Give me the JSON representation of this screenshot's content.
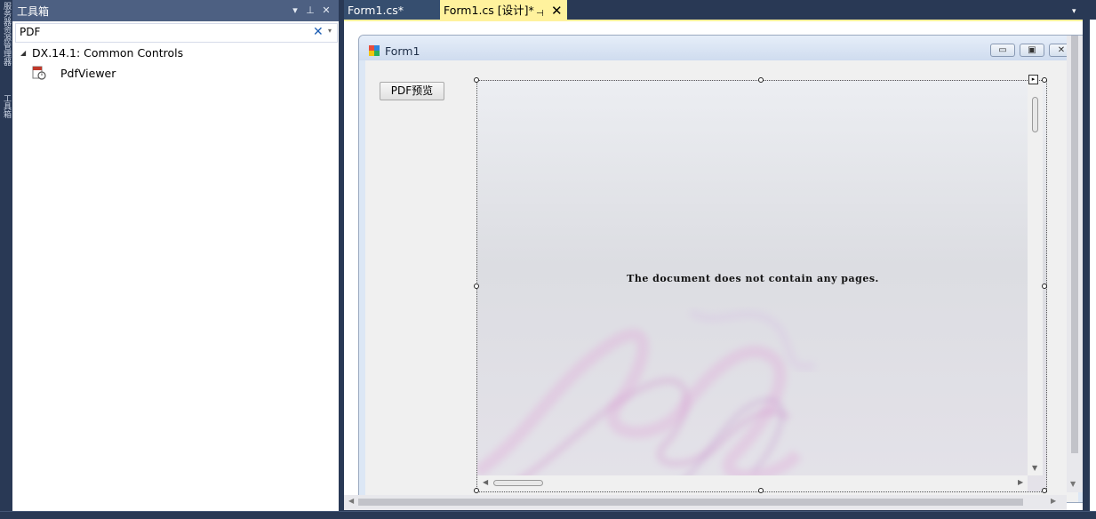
{
  "left_strip": {
    "tab1": "服务器资源管理器",
    "tab2": "工具箱"
  },
  "toolbox": {
    "title": "工具箱",
    "icons": {
      "dropdown": "▾",
      "pin": "⊥",
      "close": "✕"
    },
    "search": {
      "value": "PDF",
      "clear": "✕",
      "drop": "▾"
    },
    "group": {
      "arrow": "◢",
      "label": "DX.14.1: Common Controls"
    },
    "items": [
      {
        "label": "PdfViewer"
      }
    ]
  },
  "tabs": [
    {
      "label": "Form1.cs*"
    },
    {
      "label": "Form1.cs [设计]*",
      "pin": "⊣",
      "close": "✕"
    }
  ],
  "tab_overflow": "▾",
  "form": {
    "title": "Form1",
    "minimize": "▭",
    "maximize": "▣",
    "close": "✕",
    "button_label": "PDF预览"
  },
  "pdf_viewer": {
    "message": "The document does not contain any pages.",
    "smart_tag": "▸",
    "arrows": {
      "down": "▼",
      "left": "◀",
      "right": "▶"
    }
  },
  "outer_scroll": {
    "down": "▼",
    "left": "◀",
    "right": "▶"
  },
  "colors": {
    "ide_background": "#293955",
    "toolbox_header": "#4d6082",
    "active_tab": "#fff29d",
    "inactive_tab": "#364e6f"
  }
}
